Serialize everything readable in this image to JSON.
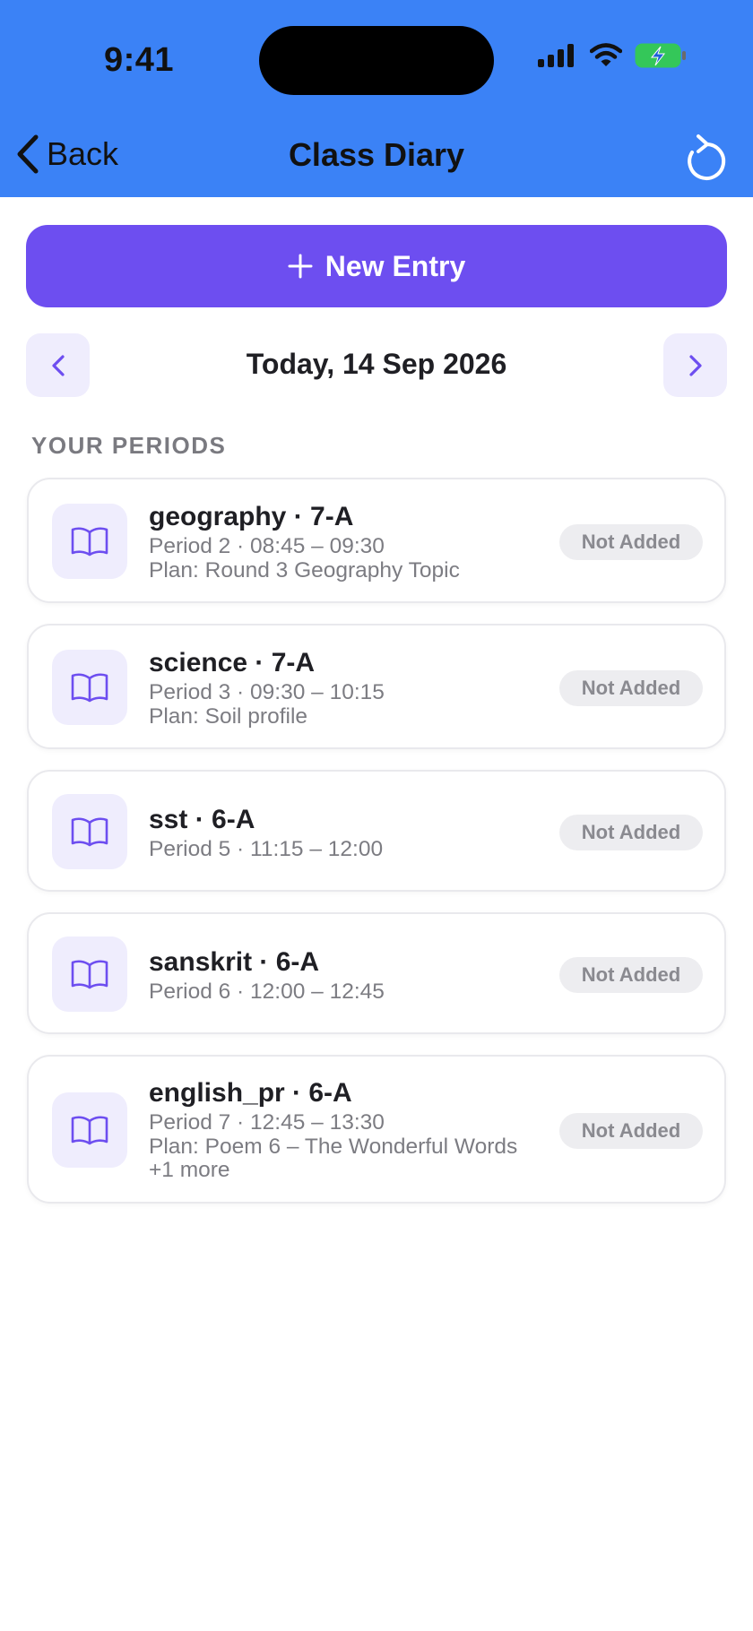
{
  "status_bar": {
    "time": "9:41"
  },
  "nav": {
    "back_label": "Back",
    "title": "Class Diary",
    "refresh_icon": "refresh-icon"
  },
  "actions": {
    "new_entry_label": "New Entry"
  },
  "date_nav": {
    "label": "Today, 14 Sep 2026"
  },
  "section": {
    "label": "YOUR PERIODS"
  },
  "periods": [
    {
      "title": "geography · 7-A",
      "time": "Period 2 · 08:45 – 09:30",
      "plan": "Plan: Round 3 Geography Topic",
      "status": "Not Added"
    },
    {
      "title": "science · 7-A",
      "time": "Period 3 · 09:30 – 10:15",
      "plan": "Plan: Soil profile",
      "status": "Not Added"
    },
    {
      "title": "sst · 6-A",
      "time": "Period 5 · 11:15 – 12:00",
      "status": "Not Added"
    },
    {
      "title": "sanskrit · 6-A",
      "time": "Period 6 · 12:00 – 12:45",
      "status": "Not Added"
    },
    {
      "title": "english_pr · 6-A",
      "time": "Period 7 · 12:45 – 13:30",
      "plan": "Plan: Poem 6 – The Wonderful Words +1 more",
      "status": "Not Added"
    }
  ],
  "colors": {
    "header": "#3b82f6",
    "primary": "#6d4ef0",
    "icon_bg": "#efedfd",
    "badge_bg": "#ededf0",
    "battery": "#34c759"
  }
}
